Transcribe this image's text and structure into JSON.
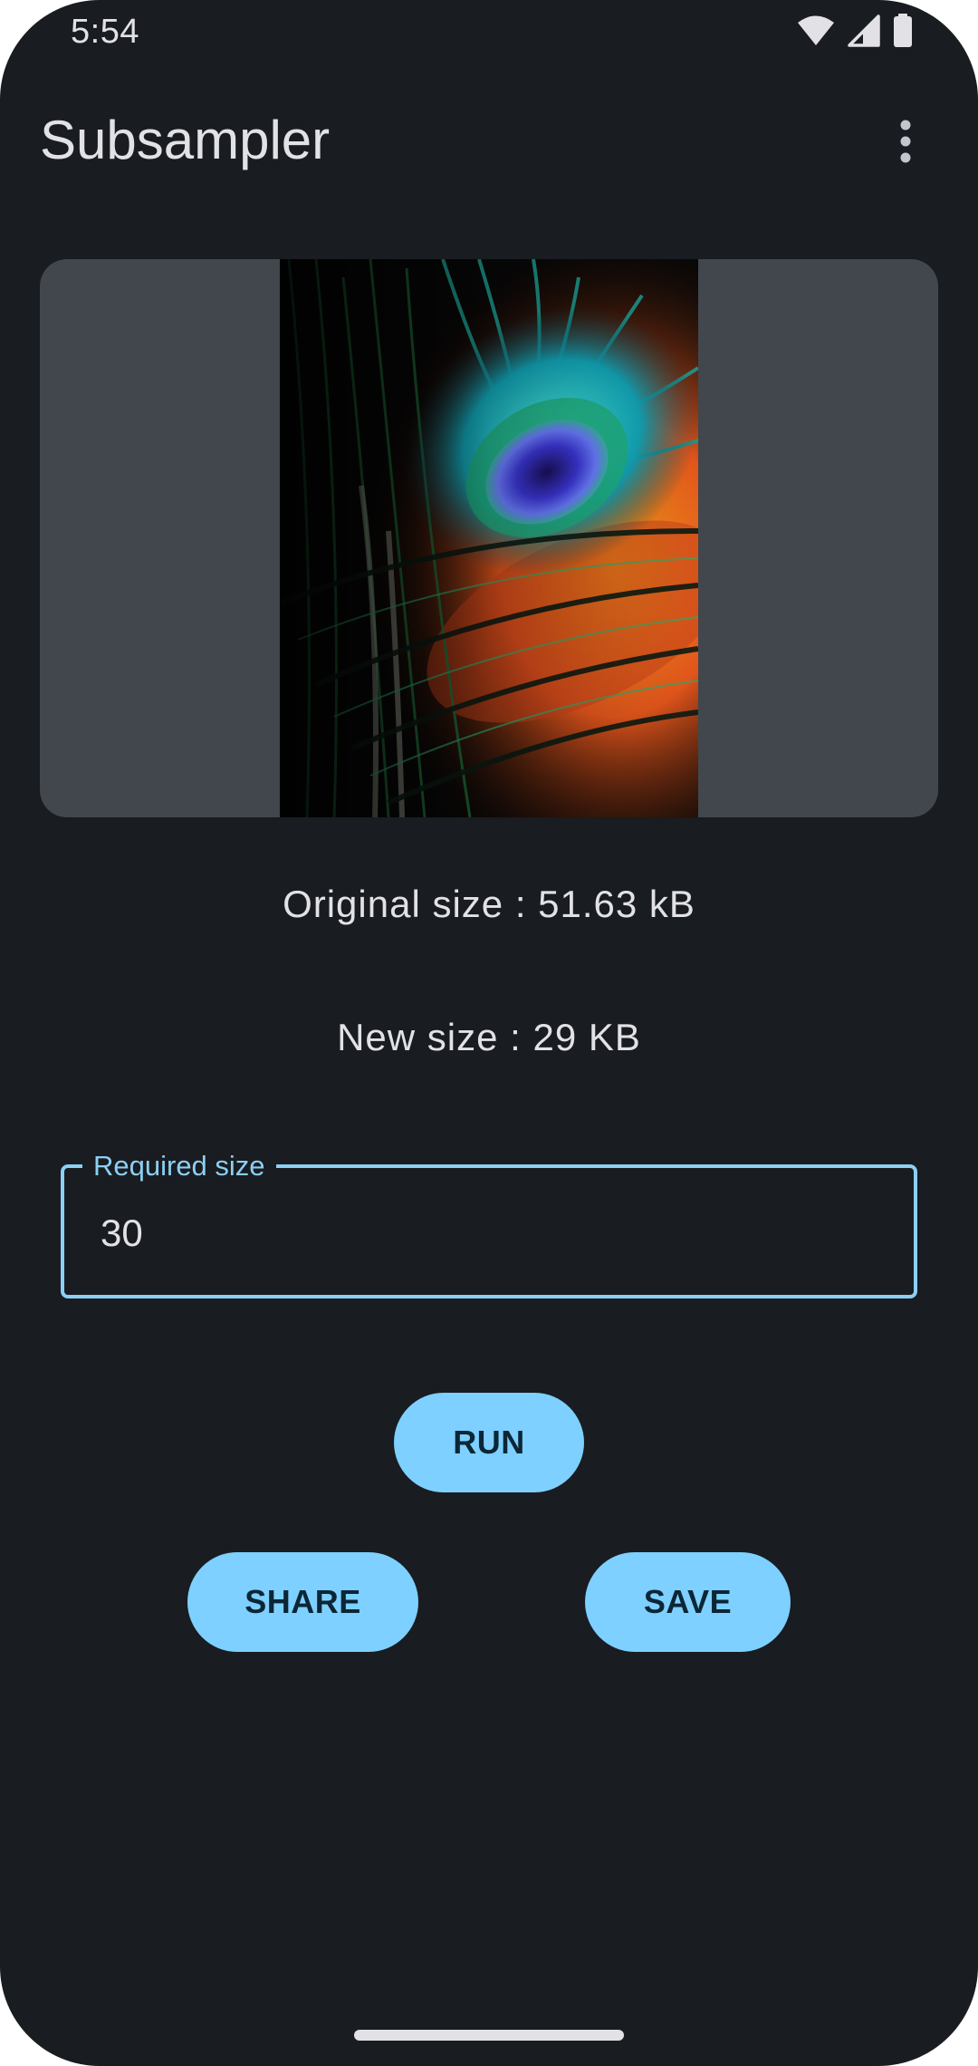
{
  "status_bar": {
    "time": "5:54",
    "icons": [
      "wifi-icon",
      "cellular-signal-icon",
      "battery-icon"
    ]
  },
  "app_bar": {
    "title": "Subsampler",
    "overflow_icon": "more-vert-icon"
  },
  "preview": {
    "image": "peacock-feather-photo"
  },
  "info": {
    "original_size": "Original size : 51.63 kB",
    "new_size": "New size : 29 KB"
  },
  "required_size_field": {
    "label": "Required size",
    "value": "30"
  },
  "buttons": {
    "run": "RUN",
    "share": "SHARE",
    "save": "SAVE"
  },
  "colors": {
    "background": "#191c20",
    "accent": "#7dd0ff",
    "outline": "#8ccff4",
    "card": "#41474d",
    "text": "#e2e2e6"
  }
}
